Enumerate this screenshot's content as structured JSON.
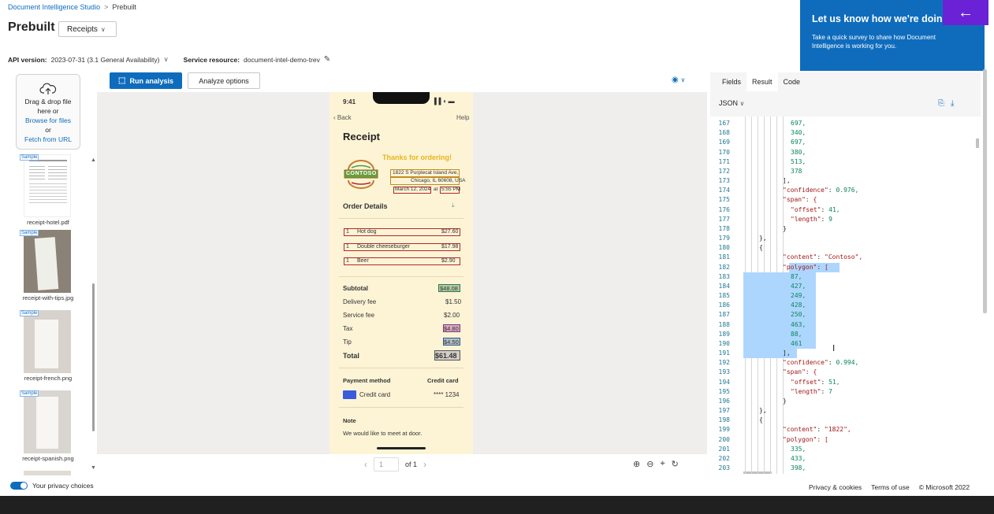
{
  "breadcrumb": {
    "root": "Document Intelligence Studio",
    "separator": ">",
    "current": "Prebuilt"
  },
  "page_title": "Prebuilt",
  "model_select": {
    "value": "Receipts"
  },
  "api": {
    "label": "API version:",
    "value": "2023-07-31 (3.1 General Availability)",
    "resource_label": "Service resource:",
    "resource_value": "document-intel-demo-trev"
  },
  "upload": {
    "line1": "Drag & drop file",
    "line2": "here or",
    "browse": "Browse for files",
    "or": "or",
    "fetch": "Fetch from URL"
  },
  "samples": [
    {
      "tag": "Sample",
      "label": "receipt-hotel.pdf"
    },
    {
      "tag": "Sample",
      "label": "receipt-with-tips.jpg"
    },
    {
      "tag": "Sample",
      "label": "receipt-french.png"
    },
    {
      "tag": "Sample",
      "label": "receipt-spanish.png"
    }
  ],
  "toolbar": {
    "run_label": "Run analysis",
    "options_label": "Analyze options"
  },
  "receipt": {
    "time": "9:41",
    "back": "Back",
    "help": "Help",
    "title": "Receipt",
    "thanks": "Thanks for ordering!",
    "logo": "CONTOSO",
    "address1": "1822 S Purplecat Island Ave,",
    "address2": "Chicago, IL 60608, USA",
    "date": "March 12, 2024",
    "at": "at",
    "time_ordered": "5:55 PM",
    "order_details": "Order Details",
    "items": [
      {
        "qty": "1",
        "name": "Hot dog",
        "price": "$27.60"
      },
      {
        "qty": "1",
        "name": "Double cheeseburger",
        "price": "$17.98"
      },
      {
        "qty": "1",
        "name": "Beer",
        "price": "$2.90"
      }
    ],
    "subtotal_label": "Subtotal",
    "subtotal": "$48.08",
    "delivery_label": "Delivery fee",
    "delivery": "$1.50",
    "service_label": "Service fee",
    "service": "$2.00",
    "tax_label": "Tax",
    "tax": "$4.80",
    "tip_label": "Tip",
    "tip": "$4.50",
    "total_label": "Total",
    "total": "$61.48",
    "payment_label": "Payment method",
    "card_label": "Credit card",
    "card_name": "Credit card",
    "card_num": "**** 1234",
    "note_label": "Note",
    "note": "We would like to meet at door."
  },
  "pager": {
    "page": "1",
    "of": "of 1"
  },
  "right_tabs": [
    "Fields",
    "Result",
    "Code"
  ],
  "json_select": "JSON",
  "code_lines": [
    {
      "n": "167",
      "t": "697,",
      "k": "num",
      "i": 3
    },
    {
      "n": "168",
      "t": "340,",
      "k": "num",
      "i": 3
    },
    {
      "n": "169",
      "t": "697,",
      "k": "num",
      "i": 3
    },
    {
      "n": "170",
      "t": "380,",
      "k": "num",
      "i": 3
    },
    {
      "n": "171",
      "t": "513,",
      "k": "num",
      "i": 3
    },
    {
      "n": "172",
      "t": "378",
      "k": "num",
      "i": 3
    },
    {
      "n": "173",
      "t": "],",
      "k": "p",
      "i": 2
    },
    {
      "n": "174",
      "t": "\"confidence\": 0.976,",
      "k": "kv",
      "i": 2
    },
    {
      "n": "175",
      "t": "\"span\": {",
      "k": "key",
      "i": 2
    },
    {
      "n": "176",
      "t": "\"offset\": 41,",
      "k": "kv",
      "i": 3
    },
    {
      "n": "177",
      "t": "\"length\": 9",
      "k": "kv",
      "i": 3
    },
    {
      "n": "178",
      "t": "}",
      "k": "p",
      "i": 2
    },
    {
      "n": "179",
      "t": "},",
      "k": "p",
      "i": 1
    },
    {
      "n": "180",
      "t": "{",
      "k": "p",
      "i": 1
    },
    {
      "n": "181",
      "t": "\"content\": \"Contoso\",",
      "k": "kv",
      "i": 2
    },
    {
      "n": "182",
      "t": "\"polygon\": [",
      "k": "key",
      "i": 2
    },
    {
      "n": "183",
      "t": "87,",
      "k": "num",
      "i": 3
    },
    {
      "n": "184",
      "t": "427,",
      "k": "num",
      "i": 3
    },
    {
      "n": "185",
      "t": "249,",
      "k": "num",
      "i": 3
    },
    {
      "n": "186",
      "t": "428,",
      "k": "num",
      "i": 3
    },
    {
      "n": "187",
      "t": "250,",
      "k": "num",
      "i": 3
    },
    {
      "n": "188",
      "t": "463,",
      "k": "num",
      "i": 3
    },
    {
      "n": "189",
      "t": "88,",
      "k": "num",
      "i": 3
    },
    {
      "n": "190",
      "t": "461",
      "k": "num",
      "i": 3
    },
    {
      "n": "191",
      "t": "],",
      "k": "p",
      "i": 2
    },
    {
      "n": "192",
      "t": "\"confidence\": 0.994,",
      "k": "kv",
      "i": 2
    },
    {
      "n": "193",
      "t": "\"span\": {",
      "k": "key",
      "i": 2
    },
    {
      "n": "194",
      "t": "\"offset\": 51,",
      "k": "kv",
      "i": 3
    },
    {
      "n": "195",
      "t": "\"length\": 7",
      "k": "kv",
      "i": 3
    },
    {
      "n": "196",
      "t": "}",
      "k": "p",
      "i": 2
    },
    {
      "n": "197",
      "t": "},",
      "k": "p",
      "i": 1
    },
    {
      "n": "198",
      "t": "{",
      "k": "p",
      "i": 1
    },
    {
      "n": "199",
      "t": "\"content\": \"1822\",",
      "k": "kv",
      "i": 2
    },
    {
      "n": "200",
      "t": "\"polygon\": [",
      "k": "key",
      "i": 2
    },
    {
      "n": "201",
      "t": "335,",
      "k": "num",
      "i": 3
    },
    {
      "n": "202",
      "t": "433,",
      "k": "num",
      "i": 3
    },
    {
      "n": "203",
      "t": "398,",
      "k": "num",
      "i": 3
    }
  ],
  "survey": {
    "title": "Let us know how we're doing",
    "text": "Take a quick survey to share how Document Intelligence is working for you."
  },
  "footer": {
    "privacy": "Your privacy choices",
    "cookies": "Privacy & cookies",
    "terms": "Terms of use",
    "copyright": "© Microsoft 2022"
  },
  "colors": {
    "accent": "#0f6cbd",
    "purple": "#6b22d6",
    "receipt_bg": "#fdf4d6"
  }
}
